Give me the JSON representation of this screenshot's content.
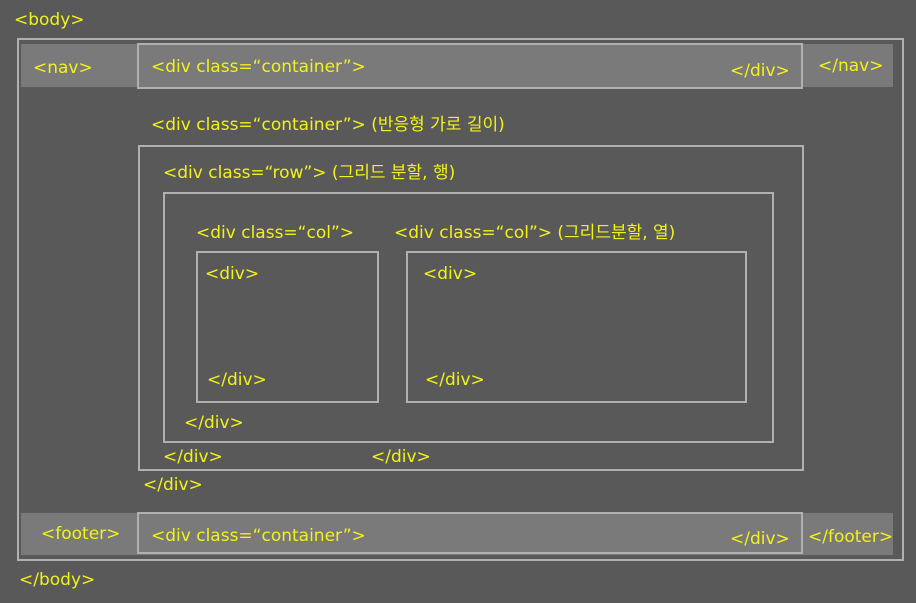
{
  "labels": {
    "body_open": "<body>",
    "body_close": "</body>",
    "nav_open": "<nav>",
    "nav_close": "</nav>",
    "nav_container_open": "<div class=“container”>",
    "nav_container_close": "</div>",
    "main_container_open": "<div class=“container”> (반응형 가로 길이)",
    "main_container_close": "</div>",
    "row_open": "<div  class=“row”> (그리드 분할, 행)",
    "row_close_a": "</div>",
    "row_close_b": "</div>",
    "col1_open": "<div class=“col”>",
    "col2_open": "<div class=“col”> (그리드분할, 열)",
    "inner_close": "</div>",
    "col1_div_open": "<div>",
    "col1_div_close": "</div>",
    "col2_div_open": "<div>",
    "col2_div_close": "</div>",
    "footer_open": "<footer>",
    "footer_close": "</footer>",
    "footer_container_open": "<div class=“container”>",
    "footer_container_close": "</div>"
  },
  "colors": {
    "background": "#595959",
    "label_text": "#f2f21a",
    "box_border": "#b0b0b0",
    "bar_fill": "#7a7a7a"
  }
}
